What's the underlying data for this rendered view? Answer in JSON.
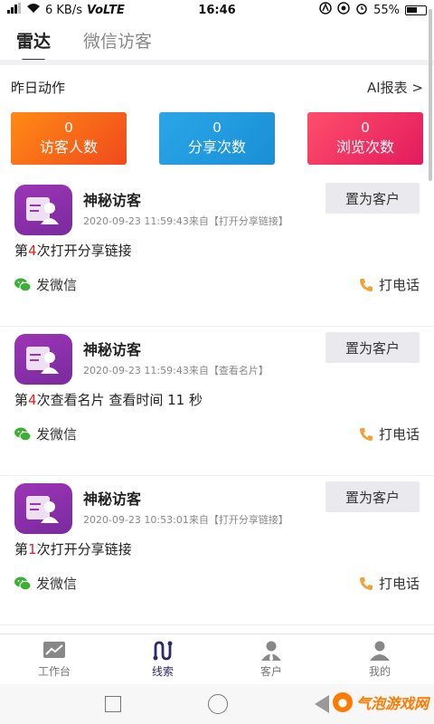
{
  "status_bar": {
    "network": "6 KB/s",
    "carrier_tag": "VoLTE",
    "time": "16:46",
    "battery": "55%"
  },
  "top_tabs": [
    {
      "label": "雷达",
      "active": true
    },
    {
      "label": "微信访客",
      "active": false
    }
  ],
  "action_header": {
    "title": "昨日动作",
    "report_link": "AI报表 >"
  },
  "stats": [
    {
      "value": "0",
      "label": "访客人数",
      "color": "#f06a1a"
    },
    {
      "value": "0",
      "label": "分享次数",
      "color": "#22a0e2"
    },
    {
      "value": "0",
      "label": "浏览次数",
      "color": "#f0336b"
    }
  ],
  "feed": [
    {
      "name": "神秘访客",
      "meta": "2020-09-23 11:59:43来自【打开分享链接】",
      "action_button": "置为客户",
      "desc_prefix": "第",
      "desc_count": "4",
      "desc_suffix": "次打开分享链接",
      "wechat_label": "发微信",
      "call_label": "打电话"
    },
    {
      "name": "神秘访客",
      "meta": "2020-09-23 11:59:43来自【查看名片】",
      "action_button": "置为客户",
      "desc_prefix": "第",
      "desc_count": "4",
      "desc_suffix": "次查看名片 查看时间 11 秒",
      "wechat_label": "发微信",
      "call_label": "打电话"
    },
    {
      "name": "神秘访客",
      "meta": "2020-09-23 10:53:01来自【打开分享链接】",
      "action_button": "置为客户",
      "desc_prefix": "第",
      "desc_count": "1",
      "desc_suffix": "次打开分享链接",
      "wechat_label": "发微信",
      "call_label": "打电话"
    }
  ],
  "bottom_nav": [
    {
      "label": "工作台",
      "icon": "chart-icon",
      "active": false
    },
    {
      "label": "线索",
      "icon": "route-icon",
      "active": true
    },
    {
      "label": "客户",
      "icon": "customer-icon",
      "active": false
    },
    {
      "label": "我的",
      "icon": "profile-icon",
      "active": false
    }
  ],
  "watermark": {
    "text": "气泡游戏网"
  },
  "colors": {
    "accent": "#2a2a6b",
    "highlight": "#e02020",
    "avatar": "#9c35b5"
  }
}
